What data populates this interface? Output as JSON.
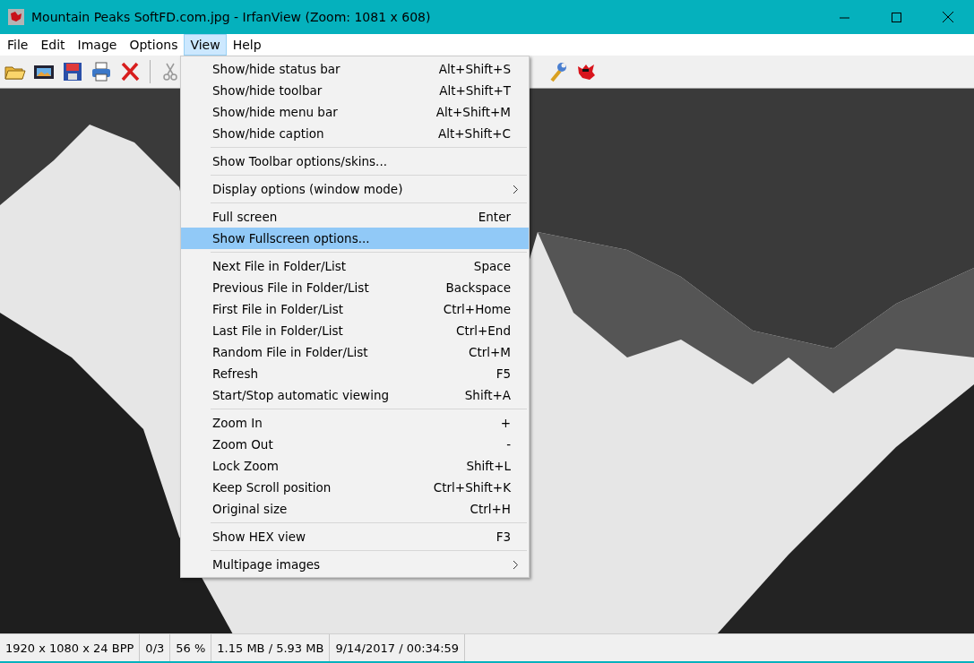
{
  "window": {
    "title": "Mountain Peaks SoftFD.com.jpg - IrfanView (Zoom: 1081 x 608)"
  },
  "menu_bar": [
    {
      "label": "File",
      "selected": false
    },
    {
      "label": "Edit",
      "selected": false
    },
    {
      "label": "Image",
      "selected": false
    },
    {
      "label": "Options",
      "selected": false
    },
    {
      "label": "View",
      "selected": true
    },
    {
      "label": "Help",
      "selected": false
    }
  ],
  "view_menu": [
    {
      "kind": "item",
      "label": "Show/hide status bar",
      "shortcut": "Alt+Shift+S",
      "selected": false
    },
    {
      "kind": "item",
      "label": "Show/hide toolbar",
      "shortcut": "Alt+Shift+T",
      "selected": false
    },
    {
      "kind": "item",
      "label": "Show/hide menu bar",
      "shortcut": "Alt+Shift+M",
      "selected": false
    },
    {
      "kind": "item",
      "label": "Show/hide caption",
      "shortcut": "Alt+Shift+C",
      "selected": false
    },
    {
      "kind": "separator"
    },
    {
      "kind": "item",
      "label": "Show Toolbar options/skins...",
      "selected": false
    },
    {
      "kind": "separator"
    },
    {
      "kind": "submenu",
      "label": "Display options (window mode)",
      "selected": false
    },
    {
      "kind": "separator"
    },
    {
      "kind": "item",
      "label": "Full screen",
      "shortcut": "Enter",
      "selected": false
    },
    {
      "kind": "item",
      "label": "Show Fullscreen options...",
      "selected": true
    },
    {
      "kind": "separator"
    },
    {
      "kind": "item",
      "label": "Next File in Folder/List",
      "shortcut": "Space",
      "selected": false
    },
    {
      "kind": "item",
      "label": "Previous File in Folder/List",
      "shortcut": "Backspace",
      "selected": false
    },
    {
      "kind": "item",
      "label": "First File in Folder/List",
      "shortcut": "Ctrl+Home",
      "selected": false
    },
    {
      "kind": "item",
      "label": "Last File in Folder/List",
      "shortcut": "Ctrl+End",
      "selected": false
    },
    {
      "kind": "item",
      "label": "Random File in Folder/List",
      "shortcut": "Ctrl+M",
      "selected": false
    },
    {
      "kind": "item",
      "label": "Refresh",
      "shortcut": "F5",
      "selected": false
    },
    {
      "kind": "item",
      "label": "Start/Stop automatic viewing",
      "shortcut": "Shift+A",
      "selected": false
    },
    {
      "kind": "separator"
    },
    {
      "kind": "item",
      "label": "Zoom In",
      "shortcut": "+",
      "selected": false
    },
    {
      "kind": "item",
      "label": "Zoom Out",
      "shortcut": "-",
      "selected": false
    },
    {
      "kind": "item",
      "label": "Lock Zoom",
      "shortcut": "Shift+L",
      "selected": false
    },
    {
      "kind": "item",
      "label": "Keep Scroll position",
      "shortcut": "Ctrl+Shift+K",
      "selected": false
    },
    {
      "kind": "item",
      "label": "Original size",
      "shortcut": "Ctrl+H",
      "selected": false
    },
    {
      "kind": "separator"
    },
    {
      "kind": "item",
      "label": "Show HEX view",
      "shortcut": "F3",
      "selected": false
    },
    {
      "kind": "separator"
    },
    {
      "kind": "submenu",
      "label": "Multipage images",
      "selected": false
    }
  ],
  "status_bar": [
    "1920 x 1080 x 24 BPP",
    "0/3",
    "56 %",
    "1.15 MB / 5.93 MB",
    "9/14/2017 / 00:34:59"
  ]
}
